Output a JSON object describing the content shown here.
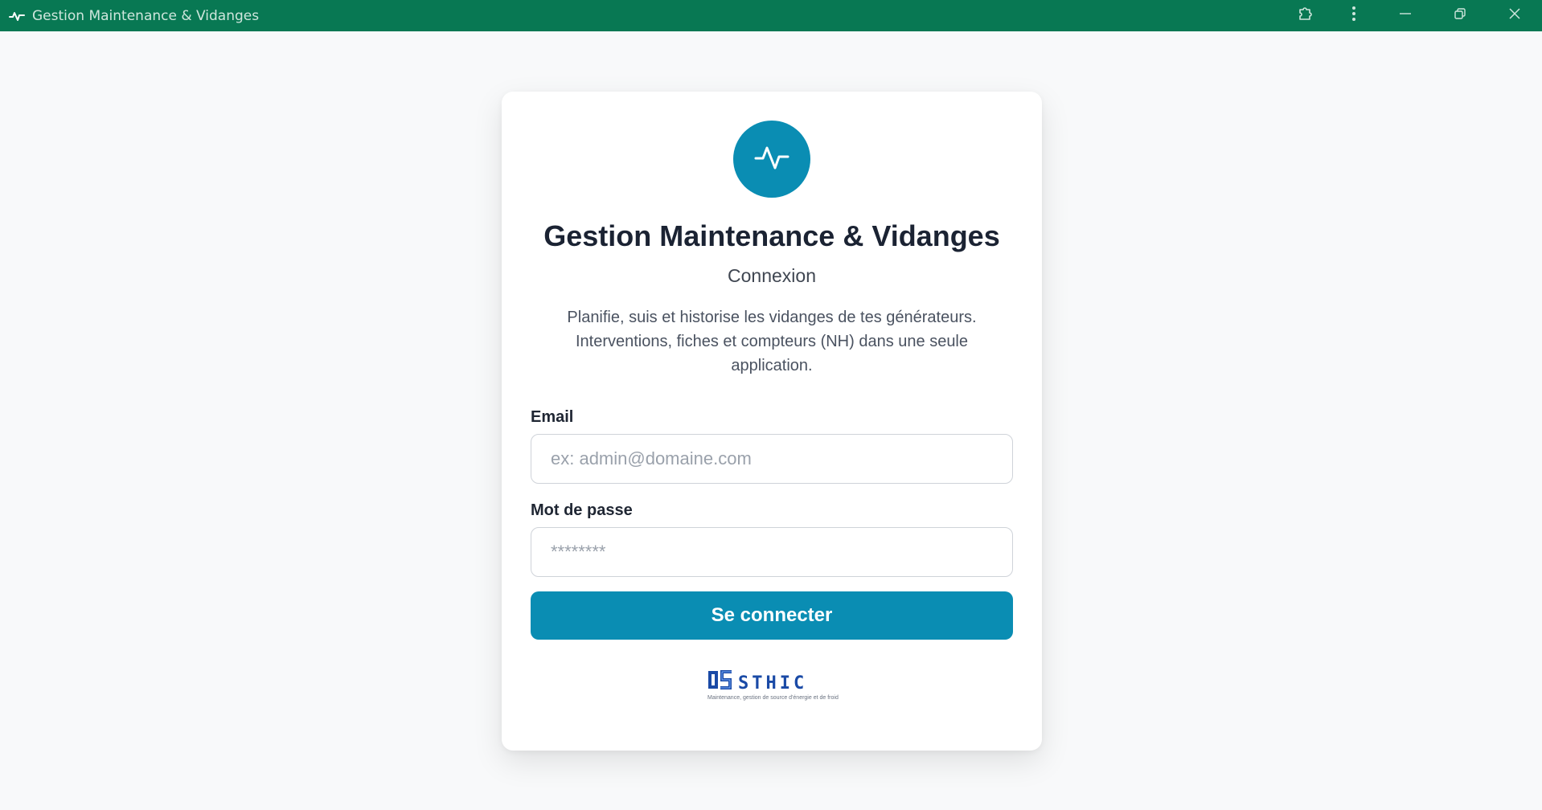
{
  "window": {
    "title": "Gestion Maintenance & Vidanges",
    "app_icon": "activity-icon",
    "controls": [
      "extension-icon",
      "more-vert-icon",
      "minimize-icon",
      "restore-icon",
      "close-icon"
    ],
    "titlebar_color": "#087853"
  },
  "login": {
    "logo_icon": "activity-icon",
    "title": "Gestion Maintenance & Vidanges",
    "subtitle": "Connexion",
    "description": "Planifie, suis et historise les vidanges de tes générateurs. Interventions, fiches et compteurs (NH) dans une seule application.",
    "email": {
      "label": "Email",
      "placeholder": "ex: admin@domaine.com",
      "value": ""
    },
    "password": {
      "label": "Mot de passe",
      "placeholder": "********",
      "value": ""
    },
    "submit_label": "Se connecter",
    "accent_color": "#0a8db3"
  },
  "brand": {
    "name": "STHIC",
    "tagline": "Maintenance, gestion de source d'énergie et de froid"
  }
}
